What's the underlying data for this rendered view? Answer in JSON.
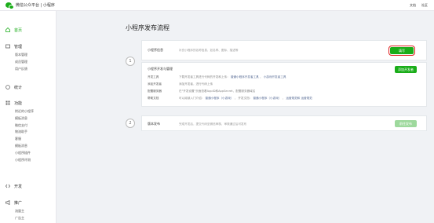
{
  "topbar": {
    "brand": "微信公众平台 | 小程序",
    "docs": "文档",
    "community": "社区"
  },
  "sidebar": {
    "home": "首页",
    "manage": {
      "title": "管理",
      "items": [
        "版本管理",
        "成员管理",
        "用户反馈"
      ]
    },
    "stats": "统计",
    "features": {
      "title": "功能",
      "items": [
        "附近的小程序",
        "模板消息",
        "微信支付",
        "物流助手",
        "客服",
        "模板消息",
        "小程序插件",
        "小程序评测"
      ]
    },
    "dev": "开发",
    "promote": {
      "title": "推广",
      "items": [
        "流量主",
        "广告主"
      ]
    }
  },
  "main": {
    "title": "小程序发布流程",
    "step1": {
      "number": "1",
      "info_label": "小程序信息",
      "info_desc": "补充小程序的名称信息，如名称、图标、描述等",
      "fill_button": "填写",
      "dev_title": "小程序开发与管理",
      "add_dev_button": "添加开发者",
      "rows": [
        {
          "label": "开发工具",
          "text": "下载开发者工具进行代码的开发和上传：",
          "links": [
            "普通小程序开发者工具",
            "小游戏开发者工具"
          ]
        },
        {
          "label": "添加开发者",
          "text": "添加开发者，进行代码上传",
          "links": []
        },
        {
          "label": "配置服务器",
          "text": "在\"开发设置\"页面查看AppID和AppSecret，配置服务器域名",
          "links": []
        },
        {
          "label": "帮助文档",
          "text": "可以阅读入门介绍：",
          "links": [
            "普通小程序（小游戏）",
            "开发文档：",
            "普通小程序（小游戏）",
            "运营规范和",
            "运营规范"
          ]
        }
      ]
    },
    "step2": {
      "number": "2",
      "label": "版本发布",
      "desc": "完成开发后，提交代码至微信审核，审核通过后可发布",
      "button": "前往发布"
    }
  },
  "colors": {
    "accent": "#1aad19",
    "link": "#576b95",
    "highlight": "#e02020"
  }
}
